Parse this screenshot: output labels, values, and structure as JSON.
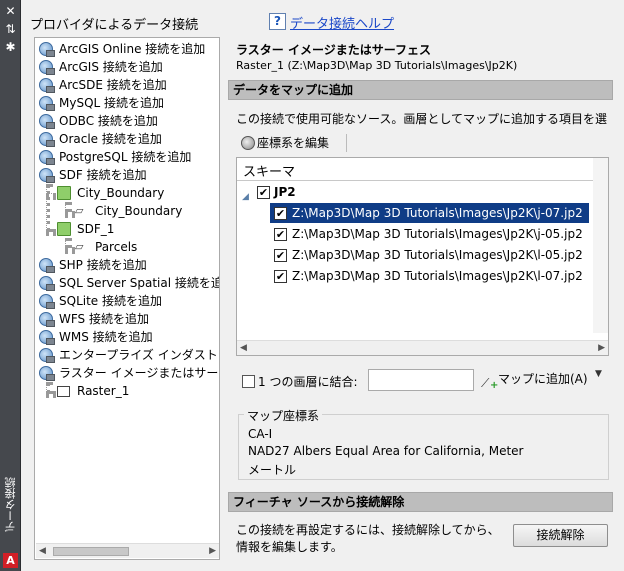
{
  "palette": {
    "titlebar": "#45484d",
    "selection": "#0f3c86",
    "section_header": "#bdbdbd",
    "link": "#1b48c8",
    "brand_logo": "#d21f26"
  },
  "window": {
    "vertical_title": "データ接続",
    "titlebar_icons": [
      "close-icon",
      "auto-hide-icon",
      "properties-icon"
    ],
    "logo_letter": "A"
  },
  "providers": {
    "title": "プロバイダによるデータ接続",
    "items": [
      {
        "label": "ArcGIS Online 接続を追加",
        "icon": "add-connection-icon"
      },
      {
        "label": "ArcGIS 接続を追加",
        "icon": "add-connection-icon"
      },
      {
        "label": "ArcSDE 接続を追加",
        "icon": "add-connection-icon"
      },
      {
        "label": "MySQL 接続を追加",
        "icon": "add-connection-icon"
      },
      {
        "label": "ODBC 接続を追加",
        "icon": "add-connection-icon"
      },
      {
        "label": "Oracle 接続を追加",
        "icon": "add-connection-icon"
      },
      {
        "label": "PostgreSQL 接続を追加",
        "icon": "add-connection-icon"
      },
      {
        "label": "SDF 接続を追加",
        "icon": "add-connection-icon"
      },
      {
        "label": "City_Boundary",
        "icon": "folder-icon"
      },
      {
        "label": "City_Boundary",
        "icon": "feature-class-icon"
      },
      {
        "label": "SDF_1",
        "icon": "folder-icon"
      },
      {
        "label": "Parcels",
        "icon": "feature-class-icon"
      },
      {
        "label": "SHP 接続を追加",
        "icon": "add-connection-icon"
      },
      {
        "label": "SQL Server Spatial 接続を追加",
        "icon": "add-connection-icon"
      },
      {
        "label": "SQLite 接続を追加",
        "icon": "add-connection-icon"
      },
      {
        "label": "WFS 接続を追加",
        "icon": "add-connection-icon"
      },
      {
        "label": "WMS 接続を追加",
        "icon": "add-connection-icon"
      },
      {
        "label": "エンタープライズ インダスト",
        "icon": "add-connection-icon"
      },
      {
        "label": "ラスター イメージまたはサー",
        "icon": "add-connection-icon"
      },
      {
        "label": "Raster_1",
        "icon": "raster-icon"
      }
    ]
  },
  "help": {
    "label": "データ接続ヘルプ"
  },
  "source": {
    "title": "ラスター イメージまたはサーフェス",
    "path": "Raster_1 (Z:\\Map3D\\Map 3D Tutorials\\Images\\Jp2K)"
  },
  "add_to_map": {
    "header": "データをマップに追加",
    "description": "この接続で使用可能なソース。画層としてマップに追加する項目を選",
    "edit_coord_button": "座標系を編集",
    "schema_header": "スキーマ",
    "group": {
      "label": "JP2",
      "checked": true
    },
    "files": [
      {
        "path": "Z:\\Map3D\\Map 3D Tutorials\\Images\\Jp2K\\j-07.jp2",
        "checked": true,
        "selected": true
      },
      {
        "path": "Z:\\Map3D\\Map 3D Tutorials\\Images\\Jp2K\\j-05.jp2",
        "checked": true,
        "selected": false
      },
      {
        "path": "Z:\\Map3D\\Map 3D Tutorials\\Images\\Jp2K\\l-05.jp2",
        "checked": true,
        "selected": false
      },
      {
        "path": "Z:\\Map3D\\Map 3D Tutorials\\Images\\Jp2K\\l-07.jp2",
        "checked": true,
        "selected": false
      }
    ],
    "combine_label": "1 つの画層に結合:",
    "combine_value": "",
    "combine_checked": false,
    "add_button": "マップに追加(A)"
  },
  "coord_system": {
    "legend": "マップ座標系",
    "code": "CA-I",
    "name": "NAD27 Albers Equal Area for California, Meter",
    "unit": "メートル"
  },
  "disconnect": {
    "header": "フィーチャ ソースから接続解除",
    "description": "この接続を再設定するには、接続解除してから、情報を編集します。",
    "button": "接続解除"
  }
}
